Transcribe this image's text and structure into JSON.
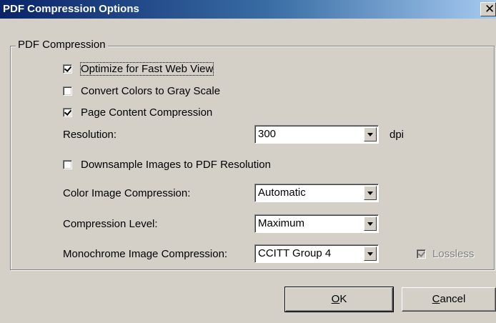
{
  "window": {
    "title": "PDF Compression Options",
    "close_glyph": "✕"
  },
  "group": {
    "legend": "PDF Compression"
  },
  "checkboxes": {
    "fast_web_view": {
      "label": "Optimize for Fast Web View",
      "checked": true
    },
    "gray_scale": {
      "label": "Convert Colors to Gray Scale",
      "checked": false
    },
    "page_content": {
      "label": "Page Content Compression",
      "checked": true
    },
    "downsample": {
      "label": "Downsample Images to PDF Resolution",
      "checked": false
    },
    "lossless": {
      "label": "Lossless",
      "checked": true,
      "disabled": true
    }
  },
  "fields": {
    "resolution": {
      "label": "Resolution:",
      "value": "300",
      "unit": "dpi"
    },
    "color_compression": {
      "label": "Color Image Compression:",
      "value": "Automatic"
    },
    "compression_level": {
      "label": "Compression Level:",
      "value": "Maximum"
    },
    "mono_compression": {
      "label": "Monochrome Image Compression:",
      "value": "CCITT Group 4"
    }
  },
  "buttons": {
    "ok": {
      "mnemonic": "O",
      "rest": "K"
    },
    "cancel": {
      "mnemonic": "C",
      "rest": "ancel"
    }
  },
  "colors": {
    "title_start": "#0a246a",
    "title_end": "#a6caf0",
    "dialog_face": "#d4d0c8",
    "disabled_text": "#808080"
  },
  "icons": {
    "close": "close-icon",
    "dropdown": "chevron-down-icon",
    "check": "checkmark-icon"
  }
}
